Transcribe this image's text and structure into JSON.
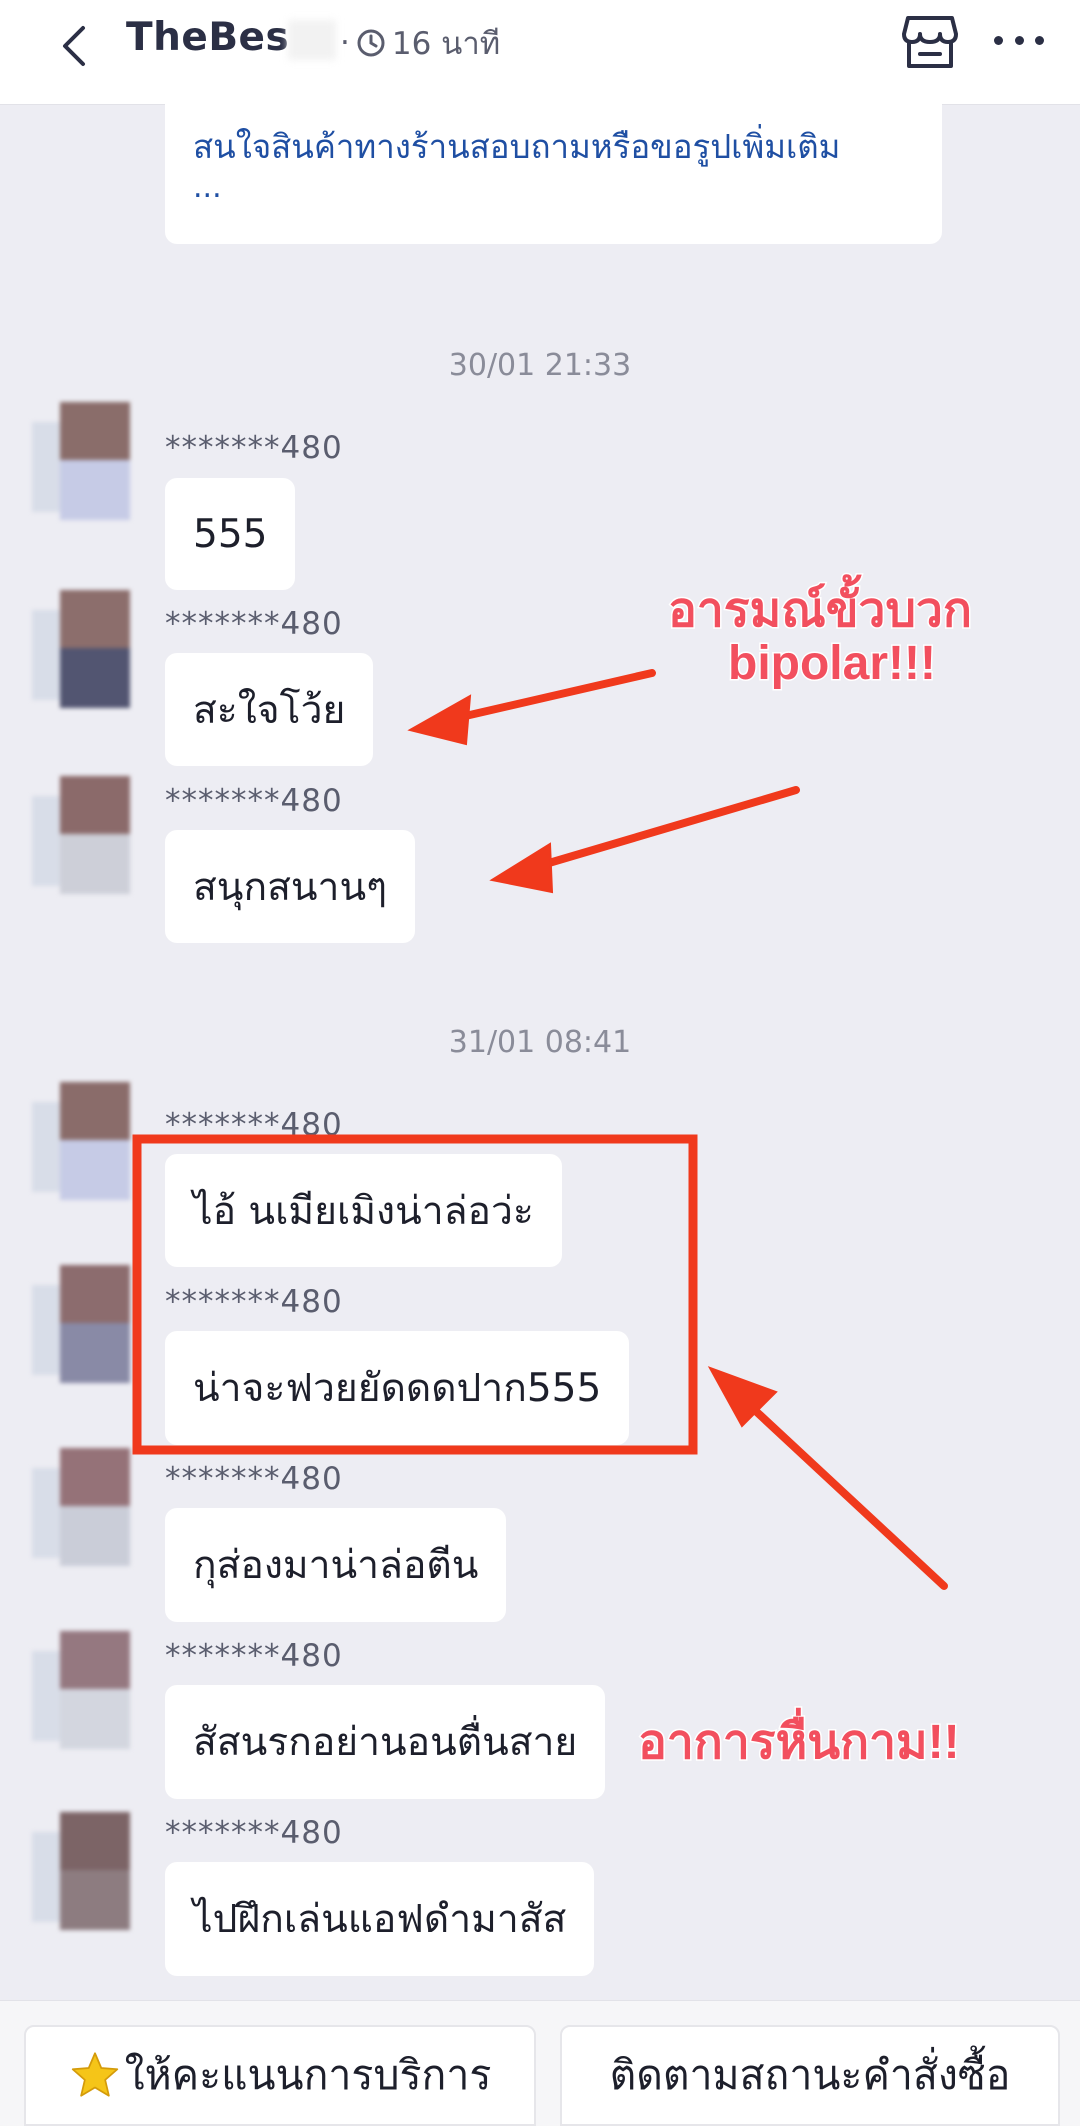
{
  "header": {
    "title": "TheBes",
    "time_ago": "16 นาที",
    "icons": [
      "back-chevron-icon",
      "clock-icon",
      "shop-icon",
      "more-icon"
    ]
  },
  "top_message": {
    "text": "สนใจสินค้าทางร้านสอบถามหรือขอรูปเพิ่มเติม",
    "ellipsis": "..."
  },
  "timestamps": [
    "30/01 21:33",
    "31/01 08:41"
  ],
  "messages": [
    {
      "sender": "*******480",
      "text": "555"
    },
    {
      "sender": "*******480",
      "text": "สะใจโว้ย"
    },
    {
      "sender": "*******480",
      "text": "สนุกสนานๆ"
    },
    {
      "sender": "*******480",
      "text": "ไอ้    นเมียเมิงน่าล่อว่ะ"
    },
    {
      "sender": "*******480",
      "text": "น่าจะฟวยยัดดดปาก555"
    },
    {
      "sender": "*******480",
      "text": "กุส่องมาน่าล่อตีน"
    },
    {
      "sender": "*******480",
      "text": "สัสนรกอย่านอนตื่นสาย"
    },
    {
      "sender": "*******480",
      "text": "ไปฝึกเล่นแอฟดำมาสัส"
    }
  ],
  "annotations": {
    "line1": "อารมณ์ขั้วบวก",
    "line2": "bipolar!!!",
    "line3": "อาการหื่นกาม!!"
  },
  "bottom_bar": {
    "rate_label": "ให้คะแนนการบริการ",
    "track_label": "ติดตามสถานะคำสั่งซื้อ"
  },
  "colors": {
    "annotation_red": "#f24f5e",
    "arrow_red": "#f0391c",
    "link_blue": "#1f4fa3",
    "chat_bg": "#ededf3"
  }
}
